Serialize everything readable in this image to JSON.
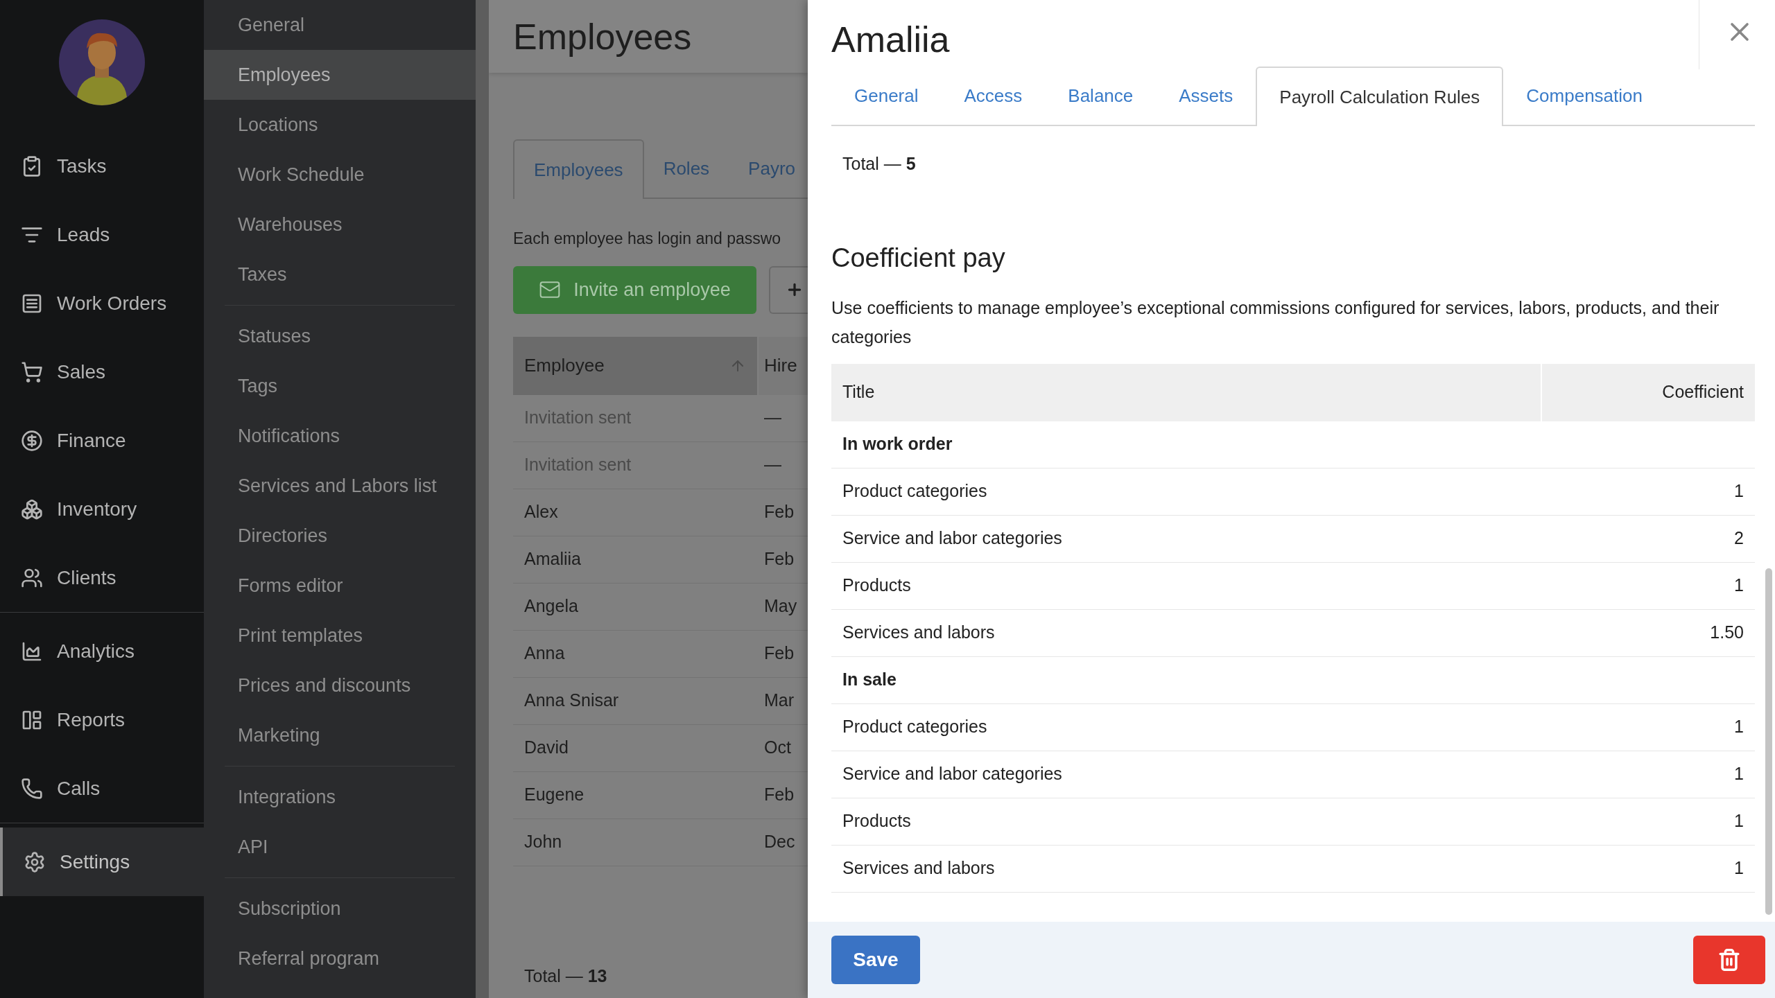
{
  "nav": {
    "groups": [
      [
        {
          "label": "Tasks",
          "selected": false
        },
        {
          "label": "Leads",
          "selected": false
        },
        {
          "label": "Work Orders",
          "selected": false
        },
        {
          "label": "Sales",
          "selected": false
        },
        {
          "label": "Finance",
          "selected": false
        },
        {
          "label": "Inventory",
          "selected": false
        },
        {
          "label": "Clients",
          "selected": false
        }
      ],
      [
        {
          "label": "Analytics",
          "selected": false
        },
        {
          "label": "Reports",
          "selected": false
        },
        {
          "label": "Calls",
          "selected": false
        }
      ],
      [
        {
          "label": "Settings",
          "selected": true
        }
      ]
    ]
  },
  "settings_menu": {
    "groups": [
      [
        {
          "label": "General",
          "selected": false
        },
        {
          "label": "Employees",
          "selected": true
        },
        {
          "label": "Locations",
          "selected": false
        },
        {
          "label": "Work Schedule",
          "selected": false
        },
        {
          "label": "Warehouses",
          "selected": false
        },
        {
          "label": "Taxes",
          "selected": false
        }
      ],
      [
        {
          "label": "Statuses",
          "selected": false
        },
        {
          "label": "Tags",
          "selected": false
        },
        {
          "label": "Notifications",
          "selected": false
        },
        {
          "label": "Services and Labors list",
          "selected": false
        },
        {
          "label": "Directories",
          "selected": false
        },
        {
          "label": "Forms editor",
          "selected": false
        },
        {
          "label": "Print templates",
          "selected": false
        },
        {
          "label": "Prices and discounts",
          "selected": false
        },
        {
          "label": "Marketing",
          "selected": false
        }
      ],
      [
        {
          "label": "Integrations",
          "selected": false
        },
        {
          "label": "API",
          "selected": false
        }
      ],
      [
        {
          "label": "Subscription",
          "selected": false
        },
        {
          "label": "Referral program",
          "selected": false
        }
      ]
    ]
  },
  "page": {
    "title": "Employees",
    "tabs": [
      {
        "label": "Employees",
        "selected": true
      },
      {
        "label": "Roles",
        "selected": false
      },
      {
        "label": "Payro",
        "selected": false
      }
    ],
    "description": "Each employee has login and passwo",
    "invite_button": "Invite an employee",
    "table": {
      "columns": [
        "Employee",
        "Hire"
      ],
      "rows": [
        {
          "kind": "invitation",
          "employee": "Invitation sent",
          "column_2": "—"
        },
        {
          "kind": "invitation",
          "employee": "Invitation sent",
          "column_2": "—"
        },
        {
          "kind": "employee",
          "employee": "Alex",
          "column_2": "Feb"
        },
        {
          "kind": "employee",
          "employee": "Amaliia",
          "column_2": "Feb"
        },
        {
          "kind": "employee",
          "employee": "Angela",
          "column_2": "May"
        },
        {
          "kind": "employee",
          "employee": "Anna",
          "column_2": "Feb"
        },
        {
          "kind": "employee",
          "employee": "Anna Snisar",
          "column_2": "Mar"
        },
        {
          "kind": "employee",
          "employee": "David",
          "column_2": "Oct"
        },
        {
          "kind": "employee",
          "employee": "Eugene",
          "column_2": "Feb"
        },
        {
          "kind": "employee",
          "employee": "John",
          "column_2": "Dec"
        }
      ]
    },
    "total": "Total — **13**"
  },
  "panel": {
    "title": "Amaliia",
    "tabs": [
      {
        "label": "General",
        "selected": false
      },
      {
        "label": "Access",
        "selected": false
      },
      {
        "label": "Balance",
        "selected": false
      },
      {
        "label": "Assets",
        "selected": false
      },
      {
        "label": "Payroll Calculation Rules",
        "selected": true
      },
      {
        "label": "Compensation",
        "selected": false
      }
    ],
    "total": "Total — **5**",
    "section_title": "Coefficient pay",
    "section_description": "Use coefficients to manage employee’s exceptional commissions configured for services, labors, products, and their categories",
    "table": {
      "columns": [
        "Title",
        "Coefficient"
      ],
      "groups": [
        {
          "title": "In work order",
          "rows": [
            {
              "title": "Product categories",
              "coefficient": "1"
            },
            {
              "title": "Service and labor categories",
              "coefficient": "2"
            },
            {
              "title": "Products",
              "coefficient": "1"
            },
            {
              "title": "Services and labors",
              "coefficient": "1.50"
            }
          ]
        },
        {
          "title": "In sale",
          "rows": [
            {
              "title": "Product categories",
              "coefficient": "1"
            },
            {
              "title": "Service and labor categories",
              "coefficient": "1"
            },
            {
              "title": "Products",
              "coefficient": "1"
            },
            {
              "title": "Services and labors",
              "coefficient": "1"
            }
          ]
        }
      ]
    },
    "save_button": "Save"
  }
}
